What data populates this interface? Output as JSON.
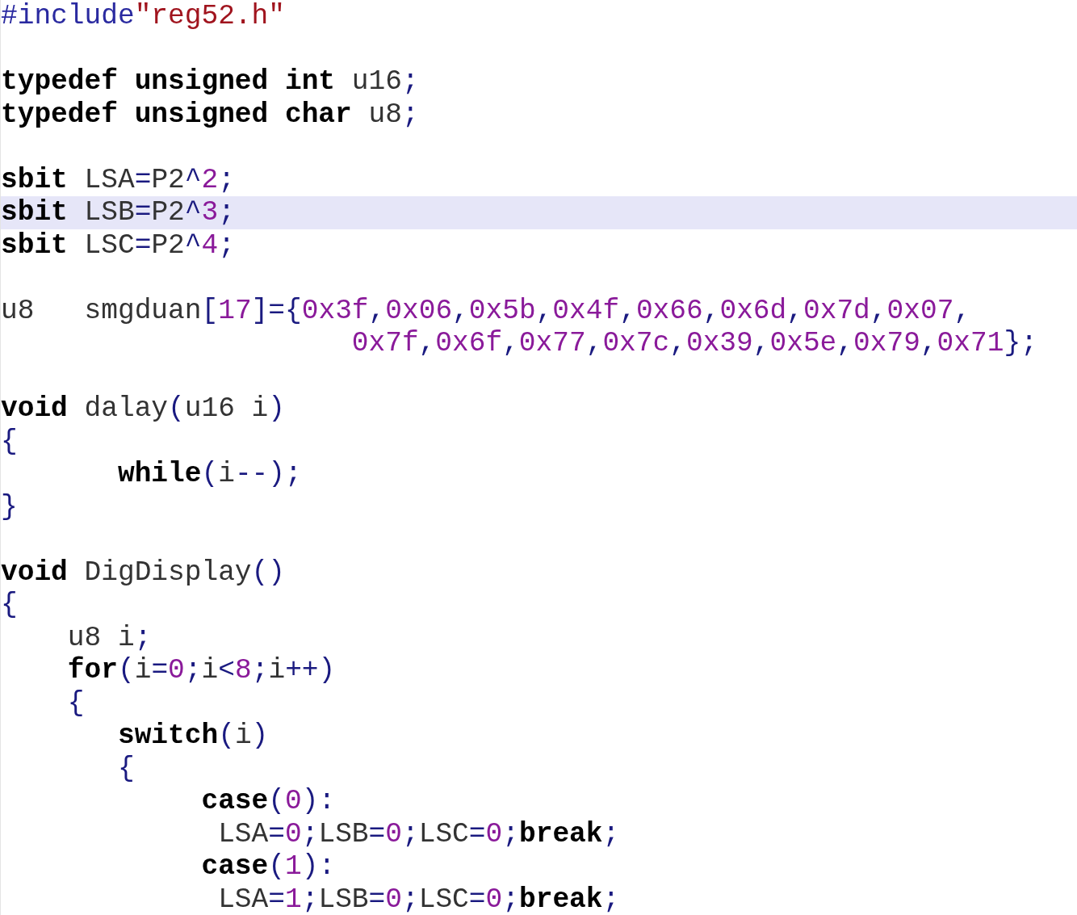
{
  "editor": {
    "lines": [
      {
        "kind": "code",
        "selected": false,
        "tokens": [
          {
            "kind": "pre",
            "text": "#include"
          },
          {
            "kind": "str",
            "text": "\"reg52.h\""
          }
        ]
      },
      {
        "kind": "blank"
      },
      {
        "kind": "code",
        "selected": false,
        "tokens": [
          {
            "kind": "kw",
            "text": "typedef unsigned int"
          },
          {
            "kind": "id",
            "text": " u16"
          },
          {
            "kind": "op",
            "text": ";"
          }
        ]
      },
      {
        "kind": "code",
        "selected": false,
        "tokens": [
          {
            "kind": "kw",
            "text": "typedef unsigned char"
          },
          {
            "kind": "id",
            "text": " u8"
          },
          {
            "kind": "op",
            "text": ";"
          }
        ]
      },
      {
        "kind": "blank"
      },
      {
        "kind": "code",
        "selected": false,
        "tokens": [
          {
            "kind": "kw",
            "text": "sbit"
          },
          {
            "kind": "id",
            "text": " LSA"
          },
          {
            "kind": "op",
            "text": "="
          },
          {
            "kind": "id",
            "text": "P2"
          },
          {
            "kind": "op",
            "text": "^"
          },
          {
            "kind": "num",
            "text": "2"
          },
          {
            "kind": "op",
            "text": ";"
          }
        ]
      },
      {
        "kind": "code",
        "selected": true,
        "tokens": [
          {
            "kind": "kw",
            "text": "sbit"
          },
          {
            "kind": "id",
            "text": " LSB"
          },
          {
            "kind": "op",
            "text": "="
          },
          {
            "kind": "id",
            "text": "P2"
          },
          {
            "kind": "op",
            "text": "^"
          },
          {
            "kind": "num",
            "text": "3"
          },
          {
            "kind": "op",
            "text": ";"
          }
        ]
      },
      {
        "kind": "code",
        "selected": false,
        "tokens": [
          {
            "kind": "kw",
            "text": "sbit"
          },
          {
            "kind": "id",
            "text": " LSC"
          },
          {
            "kind": "op",
            "text": "="
          },
          {
            "kind": "id",
            "text": "P2"
          },
          {
            "kind": "op",
            "text": "^"
          },
          {
            "kind": "num",
            "text": "4"
          },
          {
            "kind": "op",
            "text": ";"
          }
        ]
      },
      {
        "kind": "blank"
      },
      {
        "kind": "code",
        "selected": false,
        "tokens": [
          {
            "kind": "id",
            "text": "u8   smgduan"
          },
          {
            "kind": "op",
            "text": "["
          },
          {
            "kind": "num",
            "text": "17"
          },
          {
            "kind": "op",
            "text": "]={"
          },
          {
            "kind": "num",
            "text": "0x3f"
          },
          {
            "kind": "op",
            "text": ","
          },
          {
            "kind": "num",
            "text": "0x06"
          },
          {
            "kind": "op",
            "text": ","
          },
          {
            "kind": "num",
            "text": "0x5b"
          },
          {
            "kind": "op",
            "text": ","
          },
          {
            "kind": "num",
            "text": "0x4f"
          },
          {
            "kind": "op",
            "text": ","
          },
          {
            "kind": "num",
            "text": "0x66"
          },
          {
            "kind": "op",
            "text": ","
          },
          {
            "kind": "num",
            "text": "0x6d"
          },
          {
            "kind": "op",
            "text": ","
          },
          {
            "kind": "num",
            "text": "0x7d"
          },
          {
            "kind": "op",
            "text": ","
          },
          {
            "kind": "num",
            "text": "0x07"
          },
          {
            "kind": "op",
            "text": ","
          }
        ]
      },
      {
        "kind": "code",
        "selected": false,
        "tokens": [
          {
            "kind": "num",
            "text": "                     0x7f"
          },
          {
            "kind": "op",
            "text": ","
          },
          {
            "kind": "num",
            "text": "0x6f"
          },
          {
            "kind": "op",
            "text": ","
          },
          {
            "kind": "num",
            "text": "0x77"
          },
          {
            "kind": "op",
            "text": ","
          },
          {
            "kind": "num",
            "text": "0x7c"
          },
          {
            "kind": "op",
            "text": ","
          },
          {
            "kind": "num",
            "text": "0x39"
          },
          {
            "kind": "op",
            "text": ","
          },
          {
            "kind": "num",
            "text": "0x5e"
          },
          {
            "kind": "op",
            "text": ","
          },
          {
            "kind": "num",
            "text": "0x79"
          },
          {
            "kind": "op",
            "text": ","
          },
          {
            "kind": "num",
            "text": "0x71"
          },
          {
            "kind": "op",
            "text": "};"
          }
        ]
      },
      {
        "kind": "blank"
      },
      {
        "kind": "code",
        "selected": false,
        "tokens": [
          {
            "kind": "kw",
            "text": "void"
          },
          {
            "kind": "id",
            "text": " dalay"
          },
          {
            "kind": "op",
            "text": "("
          },
          {
            "kind": "id",
            "text": "u16 i"
          },
          {
            "kind": "op",
            "text": ")"
          }
        ]
      },
      {
        "kind": "code",
        "selected": false,
        "tokens": [
          {
            "kind": "op",
            "text": "{"
          }
        ]
      },
      {
        "kind": "code",
        "selected": false,
        "tokens": [
          {
            "kind": "kw",
            "text": "       while"
          },
          {
            "kind": "op",
            "text": "("
          },
          {
            "kind": "id",
            "text": "i"
          },
          {
            "kind": "op",
            "text": "--);"
          }
        ]
      },
      {
        "kind": "code",
        "selected": false,
        "tokens": [
          {
            "kind": "op",
            "text": "}"
          }
        ]
      },
      {
        "kind": "blank"
      },
      {
        "kind": "code",
        "selected": false,
        "tokens": [
          {
            "kind": "kw",
            "text": "void"
          },
          {
            "kind": "id",
            "text": " DigDisplay"
          },
          {
            "kind": "op",
            "text": "()"
          }
        ]
      },
      {
        "kind": "code",
        "selected": false,
        "tokens": [
          {
            "kind": "op",
            "text": "{"
          }
        ]
      },
      {
        "kind": "code",
        "selected": false,
        "tokens": [
          {
            "kind": "id",
            "text": "    u8 i"
          },
          {
            "kind": "op",
            "text": ";"
          }
        ]
      },
      {
        "kind": "code",
        "selected": false,
        "tokens": [
          {
            "kind": "kw",
            "text": "    for"
          },
          {
            "kind": "op",
            "text": "("
          },
          {
            "kind": "id",
            "text": "i"
          },
          {
            "kind": "op",
            "text": "="
          },
          {
            "kind": "num",
            "text": "0"
          },
          {
            "kind": "op",
            "text": ";"
          },
          {
            "kind": "id",
            "text": "i"
          },
          {
            "kind": "op",
            "text": "<"
          },
          {
            "kind": "num",
            "text": "8"
          },
          {
            "kind": "op",
            "text": ";"
          },
          {
            "kind": "id",
            "text": "i"
          },
          {
            "kind": "op",
            "text": "++)"
          }
        ]
      },
      {
        "kind": "code",
        "selected": false,
        "tokens": [
          {
            "kind": "op",
            "text": "    {"
          }
        ]
      },
      {
        "kind": "code",
        "selected": false,
        "tokens": [
          {
            "kind": "kw",
            "text": "       switch"
          },
          {
            "kind": "op",
            "text": "("
          },
          {
            "kind": "id",
            "text": "i"
          },
          {
            "kind": "op",
            "text": ")"
          }
        ]
      },
      {
        "kind": "code",
        "selected": false,
        "tokens": [
          {
            "kind": "op",
            "text": "       {"
          }
        ]
      },
      {
        "kind": "code",
        "selected": false,
        "tokens": [
          {
            "kind": "kw",
            "text": "            case"
          },
          {
            "kind": "op",
            "text": "("
          },
          {
            "kind": "num",
            "text": "0"
          },
          {
            "kind": "op",
            "text": "):"
          }
        ]
      },
      {
        "kind": "code",
        "selected": false,
        "tokens": [
          {
            "kind": "id",
            "text": "             LSA"
          },
          {
            "kind": "op",
            "text": "="
          },
          {
            "kind": "num",
            "text": "0"
          },
          {
            "kind": "op",
            "text": ";"
          },
          {
            "kind": "id",
            "text": "LSB"
          },
          {
            "kind": "op",
            "text": "="
          },
          {
            "kind": "num",
            "text": "0"
          },
          {
            "kind": "op",
            "text": ";"
          },
          {
            "kind": "id",
            "text": "LSC"
          },
          {
            "kind": "op",
            "text": "="
          },
          {
            "kind": "num",
            "text": "0"
          },
          {
            "kind": "op",
            "text": ";"
          },
          {
            "kind": "kw",
            "text": "break"
          },
          {
            "kind": "op",
            "text": ";"
          }
        ]
      },
      {
        "kind": "code",
        "selected": false,
        "tokens": [
          {
            "kind": "kw",
            "text": "            case"
          },
          {
            "kind": "op",
            "text": "("
          },
          {
            "kind": "num",
            "text": "1"
          },
          {
            "kind": "op",
            "text": "):"
          }
        ]
      },
      {
        "kind": "code",
        "selected": false,
        "tokens": [
          {
            "kind": "id",
            "text": "             LSA"
          },
          {
            "kind": "op",
            "text": "="
          },
          {
            "kind": "num",
            "text": "1"
          },
          {
            "kind": "op",
            "text": ";"
          },
          {
            "kind": "id",
            "text": "LSB"
          },
          {
            "kind": "op",
            "text": "="
          },
          {
            "kind": "num",
            "text": "0"
          },
          {
            "kind": "op",
            "text": ";"
          },
          {
            "kind": "id",
            "text": "LSC"
          },
          {
            "kind": "op",
            "text": "="
          },
          {
            "kind": "num",
            "text": "0"
          },
          {
            "kind": "op",
            "text": ";"
          },
          {
            "kind": "kw",
            "text": "break"
          },
          {
            "kind": "op",
            "text": ";"
          }
        ]
      }
    ]
  }
}
